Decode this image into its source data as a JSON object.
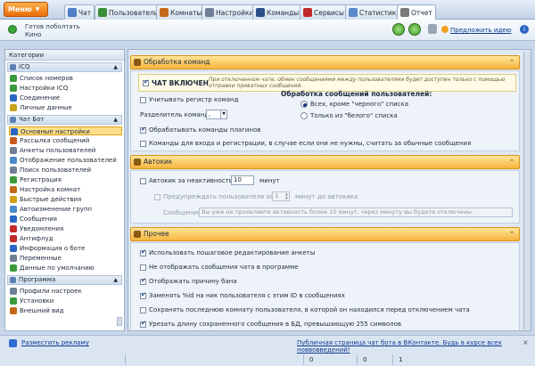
{
  "menu": {
    "label": "Меню"
  },
  "tabs": [
    {
      "label": "Чат",
      "color": "#4f7fc5"
    },
    {
      "label": "Пользователи",
      "color": "#3b8f3b"
    },
    {
      "label": "Комнаты",
      "color": "#c46a1a"
    },
    {
      "label": "Настройки",
      "color": "#6e7f96"
    },
    {
      "label": "Команды",
      "color": "#2b4f8a"
    },
    {
      "label": "Сервисы",
      "color": "#c22a2a"
    },
    {
      "label": "Статистика",
      "color": "#5a8ac9"
    },
    {
      "label": "Отчет",
      "color": "#7a7a7a"
    }
  ],
  "status": {
    "title": "Готов поболтать",
    "subtitle": "Кино"
  },
  "idea_link": "Предложить идею",
  "sidebar": {
    "header": "Категории",
    "groups": [
      {
        "label": "ICQ",
        "items": [
          {
            "label": "Список номеров",
            "color": "#3a9a3a"
          },
          {
            "label": "Настройки ICQ",
            "color": "#3a9a3a"
          },
          {
            "label": "Соединение",
            "color": "#2a67c4"
          },
          {
            "label": "Личные данные",
            "color": "#c7a11e"
          }
        ]
      },
      {
        "label": "Чат Бот",
        "items": [
          {
            "label": "Основные настройки",
            "color": "#2a67c4",
            "selected": true
          },
          {
            "label": "Рассылка сообщений",
            "color": "#c75a1e"
          },
          {
            "label": "Анкеты пользователей",
            "color": "#6e7f96"
          },
          {
            "label": "Отображение пользователей",
            "color": "#4a8ac9"
          },
          {
            "label": "Поиск пользователей",
            "color": "#6e7f96"
          },
          {
            "label": "Регистрация",
            "color": "#3a9a3a"
          },
          {
            "label": "Настройка комнат",
            "color": "#c46a1a"
          },
          {
            "label": "Быстрые действия",
            "color": "#d4a017"
          },
          {
            "label": "Автоизменение групп",
            "color": "#4a8ac9"
          },
          {
            "label": "Сообщения",
            "color": "#2a67c4"
          },
          {
            "label": "Уведомления",
            "color": "#c22a2a"
          },
          {
            "label": "Антифлуд",
            "color": "#c22a2a"
          },
          {
            "label": "Информация о боте",
            "color": "#2a67c4"
          },
          {
            "label": "Переменные",
            "color": "#6e7f96"
          },
          {
            "label": "Данные по умолчанию",
            "color": "#3a9a3a"
          }
        ]
      },
      {
        "label": "Программа",
        "items": [
          {
            "label": "Профили настроек",
            "color": "#6e7f96"
          },
          {
            "label": "Установки",
            "color": "#3a9a3a"
          },
          {
            "label": "Внешний вид",
            "color": "#c46a1a"
          }
        ]
      }
    ]
  },
  "sections": {
    "commands": {
      "title": "Обработка команд",
      "chat_enabled": "ЧАТ ВКЛЮЧЕН",
      "chat_hint": "При отключенном чате, обмен сообщениями между пользователями будет доступен только с помощью отправки приватных сообщений.",
      "case_sensitive": "Учитывать регистр команд",
      "separator_label": "Разделитель команд:",
      "separator_value": ",",
      "plugins": "Обрабатывать команды плагинов",
      "login_commands": "Команды для входа и регистрации, в случае если они не нужны, считать за обычные сообщения",
      "radio_title": "Обработка сообщений пользователей:",
      "radio_all": "Всех, кроме \"черного\" списка",
      "radio_white": "Только из \"белого\" списка"
    },
    "autokick": {
      "title": "Автокик",
      "inactivity_label": "Автокик за неактивность:",
      "inactivity_value": "10",
      "minutes": "минут",
      "warn_label": "Предупреждать пользователя за:",
      "warn_value": "1",
      "warn_suffix": "минут до автокика",
      "message_label": "Сообщение:",
      "message_value": "Вы уже не проявляете активность более 10 минут, через минуту вы будете отключены."
    },
    "other": {
      "title": "Прочее",
      "options": [
        {
          "label": "Использовать пошаговое редактирование анкеты",
          "checked": true
        },
        {
          "label": "Не отображать сообщения чата в программе",
          "checked": false
        },
        {
          "label": "Отображать причину бана",
          "checked": true
        },
        {
          "label": "Заменять %id на ник пользователя с этим ID в сообщениях",
          "checked": true
        },
        {
          "label": "Сохранять последнюю комнату пользователя, в которой он находился перед отключением чата",
          "checked": false
        },
        {
          "label": "Урезать длину сохраненного сообщения в БД, превышающую 255 символов",
          "checked": true
        }
      ]
    }
  },
  "bottom": {
    "ad_link": "Разместить рекламу",
    "vk_link": "Публичная страница чат бота в ВКонтакте. Будь в курсе всех новвовведений!",
    "close": "×",
    "counters": [
      "0",
      "0",
      "1"
    ]
  }
}
